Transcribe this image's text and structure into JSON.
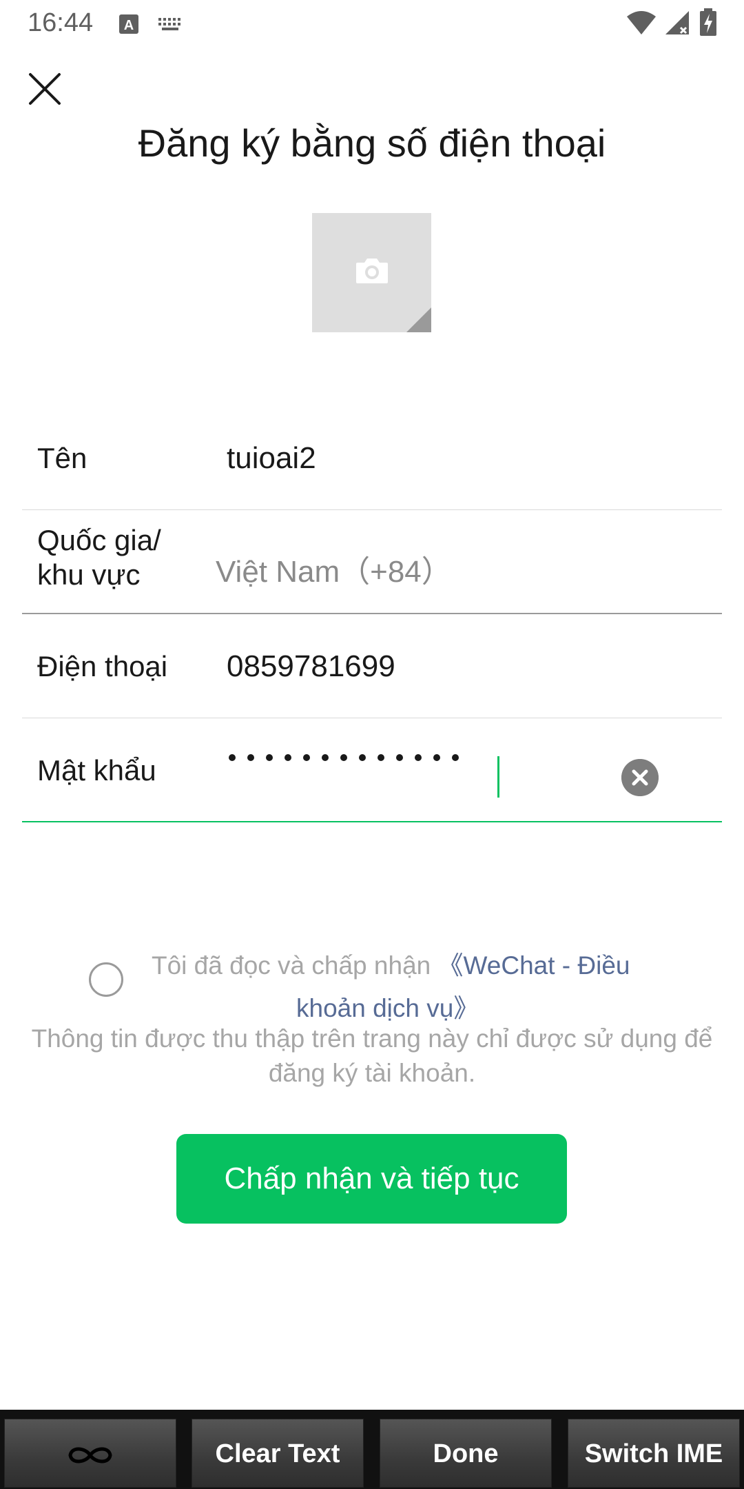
{
  "status_bar": {
    "time": "16:44",
    "icons": [
      "text-a-icon",
      "keyboard-icon",
      "wifi-icon",
      "signal-icon",
      "battery-charging-icon"
    ]
  },
  "header": {
    "close_icon": "close-icon",
    "title": "Đăng ký bằng số điện thoại"
  },
  "avatar": {
    "icon": "camera-icon"
  },
  "form": {
    "name": {
      "label": "Tên",
      "value": "tuioai2"
    },
    "region": {
      "label_line1": "Quốc gia/",
      "label_line2": "khu vực",
      "value": "Việt Nam（+84）"
    },
    "phone": {
      "label": "Điện thoại",
      "value": "0859781699"
    },
    "password": {
      "label": "Mật khẩu",
      "dots": 13
    }
  },
  "agreement": {
    "text": "Tôi đã đọc và chấp nhận",
    "link_part1": "《WeChat - Điều",
    "link_part2": "khoản dịch vụ》",
    "info": "Thông tin được thu thập trên trang này chỉ được sử dụng để đăng ký tài khoản."
  },
  "accept_button": "Chấp nhận và tiếp tục",
  "ime_bar": {
    "keys": [
      "",
      "Clear Text",
      "Done",
      "Switch IME"
    ]
  },
  "colors": {
    "accent": "#07c160",
    "link": "#576b95"
  }
}
